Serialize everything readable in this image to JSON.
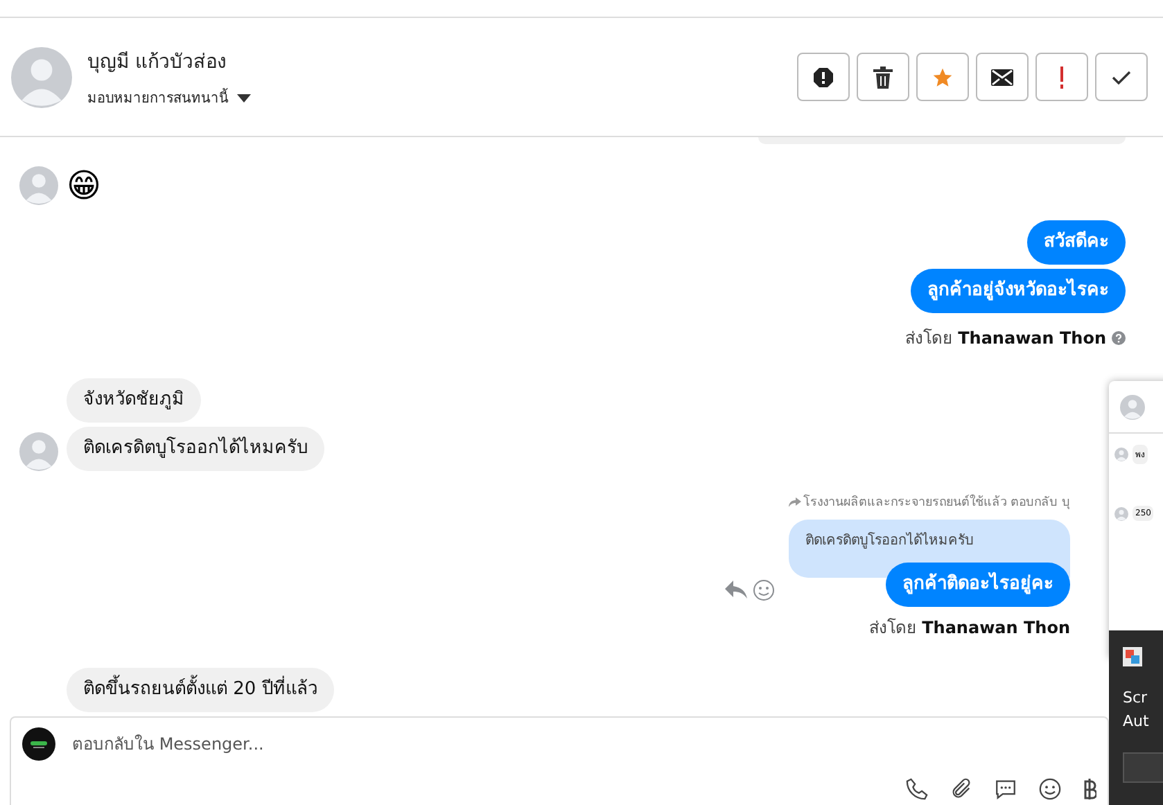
{
  "contact": {
    "name": "บุญมี แก้วบัวส่อง",
    "assign_label": "มอบหมายการสนทนานี้"
  },
  "actions": [
    {
      "kind": "spam"
    },
    {
      "kind": "delete"
    },
    {
      "kind": "star"
    },
    {
      "kind": "mail"
    },
    {
      "kind": "important"
    },
    {
      "kind": "done"
    }
  ],
  "messages": [
    {
      "kind": "emoji",
      "text": "😁",
      "avatar": true
    },
    {
      "kind": "outgoing",
      "text": "สวัสดีคะ"
    },
    {
      "kind": "outgoing",
      "text": "ลูกค้าอยู่จังหวัดอะไรคะ"
    },
    {
      "kind": "sender",
      "label": "ส่งโดย",
      "name": "Thanawan Thon",
      "help_icon": true
    },
    {
      "kind": "incoming",
      "text": "จังหวัดชัยภูมิ",
      "avatar": false
    },
    {
      "kind": "incoming",
      "text": "ติดเครดิตบูโรออกได้ไหมครับ",
      "avatar": true
    },
    {
      "kind": "reply",
      "quote_label": "โรงงานผลิตและกระจายรถยนต์ใช้แล้ว ตอบกลับ บุ",
      "quoted": "ติดเครดิตบูโรออกได้ไหมครับ",
      "text": "ลูกค้าติดอะไรอยู่คะ"
    },
    {
      "kind": "sender",
      "label": "ส่งโดย",
      "name": "Thanawan Thon",
      "help_icon": false
    },
    {
      "kind": "incoming",
      "text": "ติดขึ้นรถยนต์ตั้งแต่ 20 ปีที่แล้ว",
      "avatar": false
    }
  ],
  "composer": {
    "placeholder": "ตอบกลับใน Messenger..."
  },
  "preview_window": {
    "rows": [
      "พง",
      "250"
    ]
  },
  "notification": {
    "lines": [
      "Scr",
      "Aut"
    ]
  }
}
